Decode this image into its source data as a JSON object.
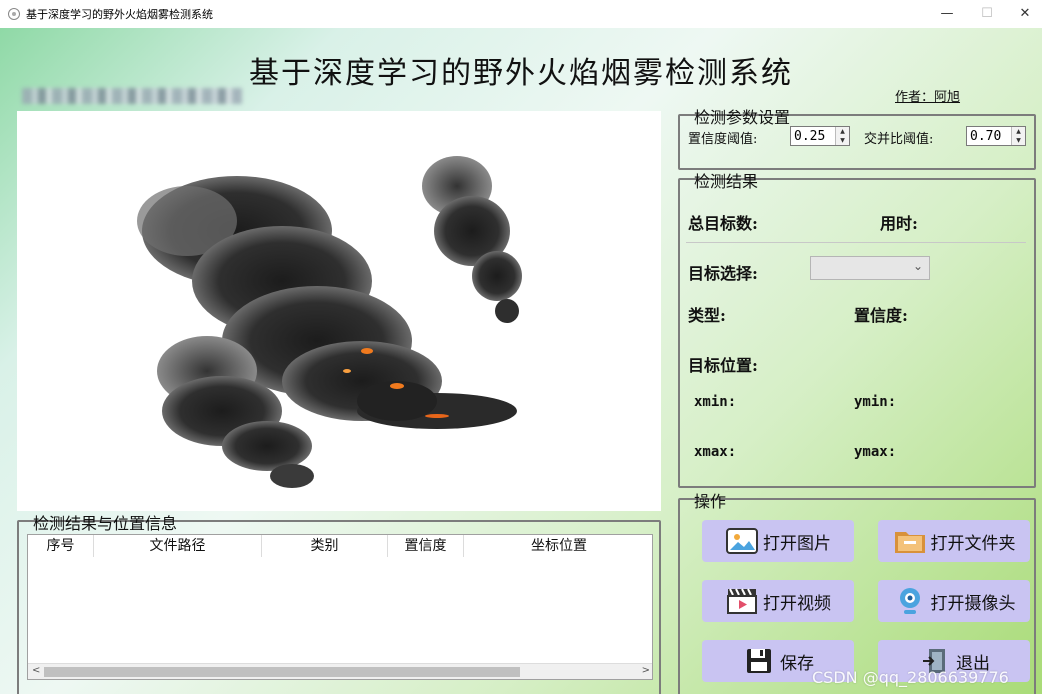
{
  "window": {
    "title": "基于深度学习的野外火焰烟雾检测系统",
    "minimize": "—",
    "maximize": "☐",
    "close": "✕"
  },
  "header": {
    "title": "基于深度学习的野外火焰烟雾检测系统",
    "author": "作者：阿旭"
  },
  "params": {
    "legend": "检测参数设置",
    "conf_label": "置信度阈值:",
    "conf_value": "0.25",
    "iou_label": "交并比阈值:",
    "iou_value": "0.70"
  },
  "results": {
    "legend": "检测结果",
    "total_label": "总目标数:",
    "time_label": "用时:",
    "select_label": "目标选择:",
    "type_label": "类型:",
    "conf_label": "置信度:",
    "pos_label": "目标位置:",
    "xmin": "xmin:",
    "ymin": "ymin:",
    "xmax": "xmax:",
    "ymax": "ymax:"
  },
  "operations": {
    "legend": "操作",
    "open_image": "打开图片",
    "open_folder": "打开文件夹",
    "open_video": "打开视频",
    "open_camera": "打开摄像头",
    "save": "保存",
    "exit": "退出"
  },
  "table": {
    "legend": "检测结果与位置信息",
    "columns": [
      "序号",
      "文件路径",
      "类别",
      "置信度",
      "坐标位置"
    ]
  },
  "watermark": "CSDN @qq_2806639776",
  "colors": {
    "button_bg": "#c9c4f2",
    "fire": "#f07a1e"
  }
}
